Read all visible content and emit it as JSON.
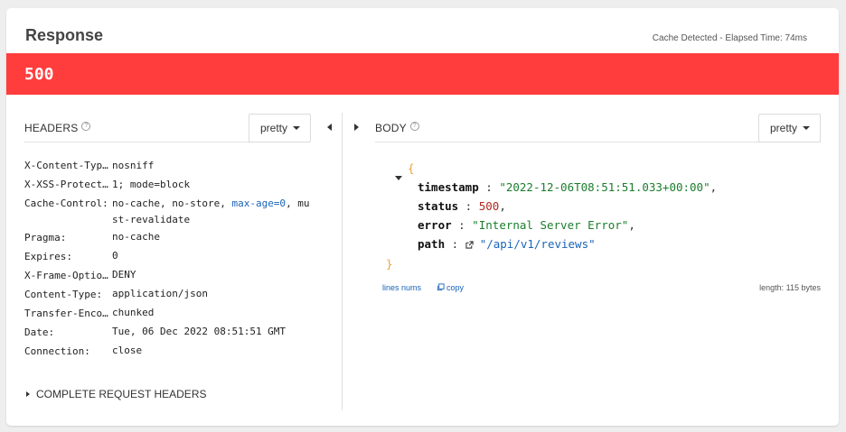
{
  "response": {
    "title": "Response",
    "meta": "Cache Detected - Elapsed Time: 74ms",
    "status_code": "500",
    "status_color": "#ff3d3d"
  },
  "headers_panel": {
    "title": "HEADERS",
    "format_label": "pretty",
    "rows": [
      {
        "name": "X-Content-Typ…",
        "value": "nosniff"
      },
      {
        "name": "X-XSS-Protect…",
        "value": "1; mode=block"
      },
      {
        "name": "Cache-Control:",
        "value_pre": "no-cache, no-store, ",
        "value_link": "max-age=0",
        "value_post": ", must-revalidate"
      },
      {
        "name": "Pragma:",
        "value": "no-cache"
      },
      {
        "name": "Expires:",
        "value": "0"
      },
      {
        "name": "X-Frame-Optio…",
        "value": "DENY"
      },
      {
        "name": "Content-Type:",
        "value": "application/json"
      },
      {
        "name": "Transfer-Enco…",
        "value": "chunked"
      },
      {
        "name": "Date:",
        "value": "Tue, 06 Dec 2022 08:51:51 GMT"
      },
      {
        "name": "Connection:",
        "value": "close"
      }
    ],
    "complete_request_headers": "COMPLETE REQUEST HEADERS"
  },
  "body_panel": {
    "title": "BODY",
    "format_label": "pretty",
    "json": {
      "open_brace": "{",
      "close_brace": "}",
      "timestamp_key": "timestamp",
      "timestamp_value": "\"2022-12-06T08:51:51.033+00:00\"",
      "status_key": "status",
      "status_value": "500",
      "error_key": "error",
      "error_value": "\"Internal Server Error\"",
      "path_key": "path",
      "path_value": "\"/api/v1/reviews\""
    },
    "lines_nums_label": "lines nums",
    "copy_label": "copy",
    "length_label": "length: 115 bytes"
  },
  "icons": {
    "help": "help-circle-icon",
    "external_link": "external-link-icon",
    "copy": "copy-icon"
  }
}
